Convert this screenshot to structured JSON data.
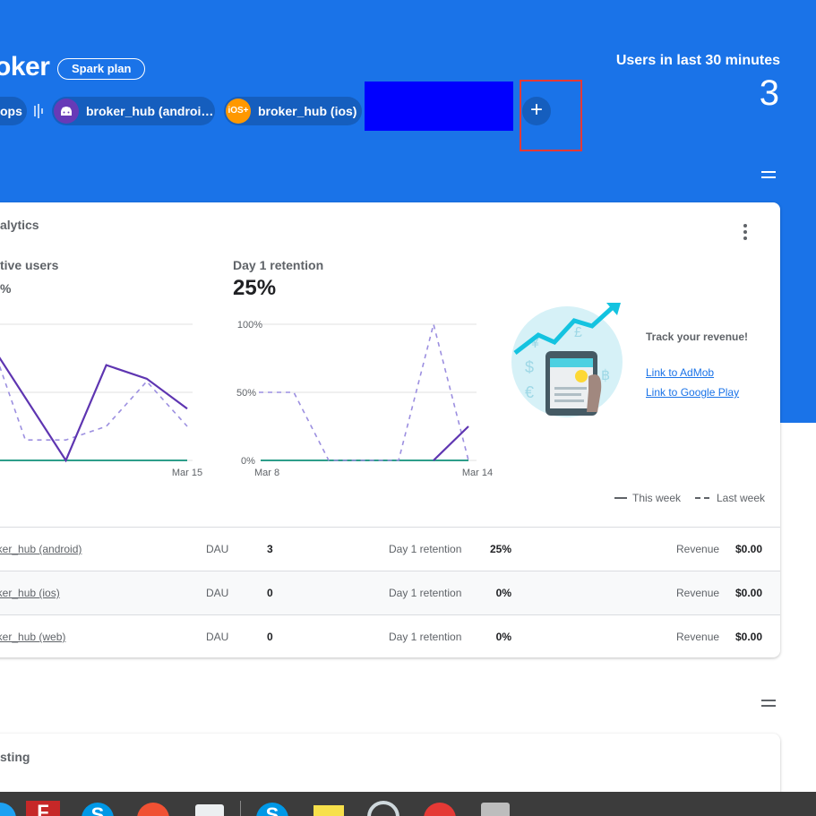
{
  "header": {
    "project_name": "oker",
    "plan_chip": "Spark plan",
    "users_label": "Users in last 30 minutes",
    "users_count": "3",
    "apps_chip": "ops",
    "apps": [
      {
        "label": "broker_hub (androi…",
        "icon": "android-icon"
      },
      {
        "label": "broker_hub (ios)",
        "icon": "ios-icon",
        "icon_text": "iOS+"
      }
    ],
    "add_button": "+"
  },
  "analytics": {
    "title": "alytics",
    "active_users_label": "tive users",
    "active_users_value": "%",
    "retention_label": "Day 1 retention",
    "retention_value": "25%",
    "promo": {
      "title": "Track your revenue!",
      "link_admob": "Link to AdMob",
      "link_play": "Link to Google Play"
    },
    "legend": {
      "this_week": "This week",
      "last_week": "Last week"
    },
    "rows": [
      {
        "app": "oker_hub (android)",
        "dau_label": "DAU",
        "dau": "3",
        "ret_label": "Day 1 retention",
        "ret": "25%",
        "rev_label": "Revenue",
        "rev": "$0.00"
      },
      {
        "app": "oker_hub (ios)",
        "dau_label": "DAU",
        "dau": "0",
        "ret_label": "Day 1 retention",
        "ret": "0%",
        "rev_label": "Revenue",
        "rev": "$0.00"
      },
      {
        "app": "oker_hub (web)",
        "dau_label": "DAU",
        "dau": "0",
        "ret_label": "Day 1 retention",
        "ret": "0%",
        "rev_label": "Revenue",
        "rev": "$0.00"
      }
    ]
  },
  "second_card": {
    "title": "sting"
  },
  "taskbar": {
    "icons": [
      "flash-icon",
      "skype-icon",
      "git-icon",
      "text-editor-icon",
      "skype-icon",
      "sticky-notes-icon",
      "settings-gear-icon",
      "red-app-icon",
      "drive-icon"
    ]
  },
  "colors": {
    "brand_blue": "#1a73e8",
    "series_this_week": "#5e35b1",
    "series_last_week": "#9c8fe0",
    "series_baseline": "#2e9e8a"
  },
  "chart_data": [
    {
      "type": "line",
      "title": "tive users",
      "x_last_label": "Mar 15",
      "series": [
        {
          "name": "This week",
          "values": [
            80,
            92,
            null,
            0,
            70,
            60,
            38
          ]
        },
        {
          "name": "Last week",
          "values": [
            null,
            100,
            15,
            15,
            25,
            58,
            25
          ]
        }
      ]
    },
    {
      "type": "line",
      "title": "Day 1 retention",
      "y_ticks": [
        "100%",
        "50%",
        "0%"
      ],
      "x_tick_labels": [
        "Mar 8",
        "Mar 14"
      ],
      "ylim": [
        0,
        100
      ],
      "series": [
        {
          "name": "This week",
          "values": [
            0,
            0,
            0,
            0,
            0,
            0,
            25
          ]
        },
        {
          "name": "Last week",
          "values": [
            50,
            50,
            0,
            0,
            0,
            100,
            0
          ]
        }
      ]
    }
  ]
}
